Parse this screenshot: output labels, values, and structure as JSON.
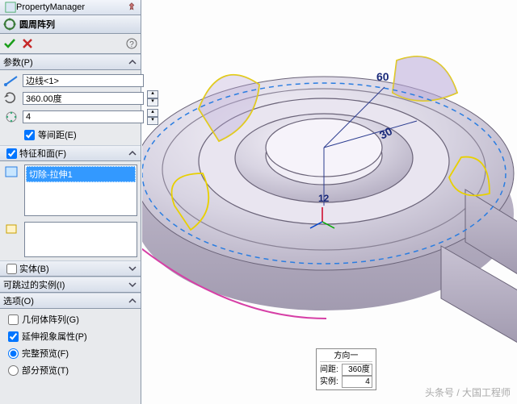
{
  "pm": {
    "title": "PropertyManager"
  },
  "feature": {
    "title": "圆周阵列"
  },
  "params": {
    "header": "参数(P)",
    "axis": "边线<1>",
    "angle": "360.00度",
    "count": "4",
    "equal_spacing": "等间距(E)"
  },
  "features_faces": {
    "header": "特征和面(F)",
    "item": "切除-拉伸1"
  },
  "bodies": {
    "header": "实体(B)"
  },
  "skip": {
    "header": "可跳过的实例(I)"
  },
  "options": {
    "header": "选项(O)",
    "geom_pattern": "几何体阵列(G)",
    "propagate_vis": "延伸视象属性(P)",
    "full_preview": "完整预览(F)",
    "partial_preview": "部分预览(T)"
  },
  "callout": {
    "title": "方向一",
    "spacing_label": "间距:",
    "spacing_value": "360度",
    "instances_label": "实例:",
    "instances_value": "4"
  },
  "dims": {
    "d60": "60",
    "d30": "30",
    "d12": "12"
  },
  "watermark": "头条号 / 大国工程师"
}
